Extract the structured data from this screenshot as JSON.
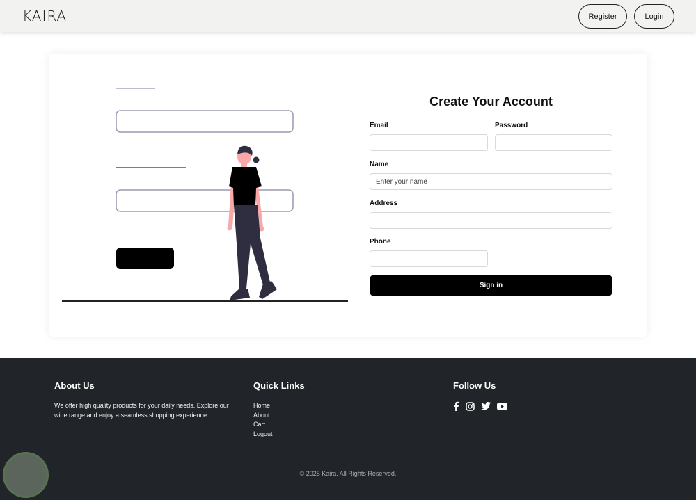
{
  "navbar": {
    "brand": "KAIRA",
    "register_label": "Register",
    "login_label": "Login"
  },
  "form": {
    "title": "Create Your Account",
    "email_label": "Email",
    "password_label": "Password",
    "name_label": "Name",
    "name_placeholder": "Enter your name",
    "address_label": "Address",
    "phone_label": "Phone",
    "submit_label": "Sign in"
  },
  "footer": {
    "about_heading": "About Us",
    "about_text": "We offer high quality products for your daily needs. Explore our wide range and enjoy a seamless shopping experience.",
    "links_heading": "Quick Links",
    "links": [
      "Home",
      "About",
      "Cart",
      "Logout"
    ],
    "follow_heading": "Follow Us",
    "socials": [
      "facebook-icon",
      "instagram-icon",
      "twitter-icon",
      "youtube-icon"
    ],
    "copyright": "© 2025 Kaira. All Rights Reserved."
  },
  "colors": {
    "footer_bg": "#212529",
    "button_bg": "#000000",
    "navbar_bg": "#f2f2f0",
    "illustration_skin": "#f9a8a8",
    "illustration_pants": "#2f2e41"
  }
}
